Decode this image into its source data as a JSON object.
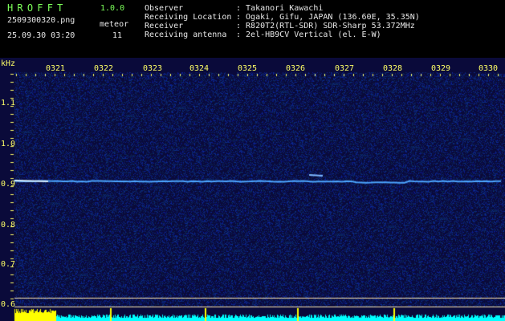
{
  "app": {
    "title": "HROFFT",
    "version": "1.0.0"
  },
  "capture": {
    "file_name": "2509300320.png",
    "meteor_label": "meteor",
    "date_time": "25.09.30 03:20",
    "meteor_count": "11"
  },
  "station_info": [
    {
      "label": "Observer",
      "value": ": Takanori Kawachi"
    },
    {
      "label": "Receiving Location",
      "value": ": Ogaki, Gifu, JAPAN (136.60E, 35.35N)"
    },
    {
      "label": "Receiver",
      "value": ": R820T2(RTL-SDR) SDR-Sharp 53.372MHz"
    },
    {
      "label": "Receiving antenna",
      "value": ": 2el-HB9CV Vertical (el. E-W)"
    }
  ],
  "axis": {
    "unit": "kHz",
    "time_labels": [
      "0321",
      "0322",
      "0323",
      "0324",
      "0325",
      "0326",
      "0327",
      "0328",
      "0329",
      "0330"
    ],
    "freq_labels": [
      "1.1",
      "1.0",
      "0.9",
      "0.8",
      "0.7",
      "0.6"
    ]
  },
  "colors": {
    "text_green": "#7cff5a",
    "axis_yellow": "#ffff66",
    "waterfall_bg": "#0a0a3a",
    "signal_line": "#4da6ff",
    "level_bar": "#00ffff",
    "level_bar_hot": "#ffff00"
  }
}
